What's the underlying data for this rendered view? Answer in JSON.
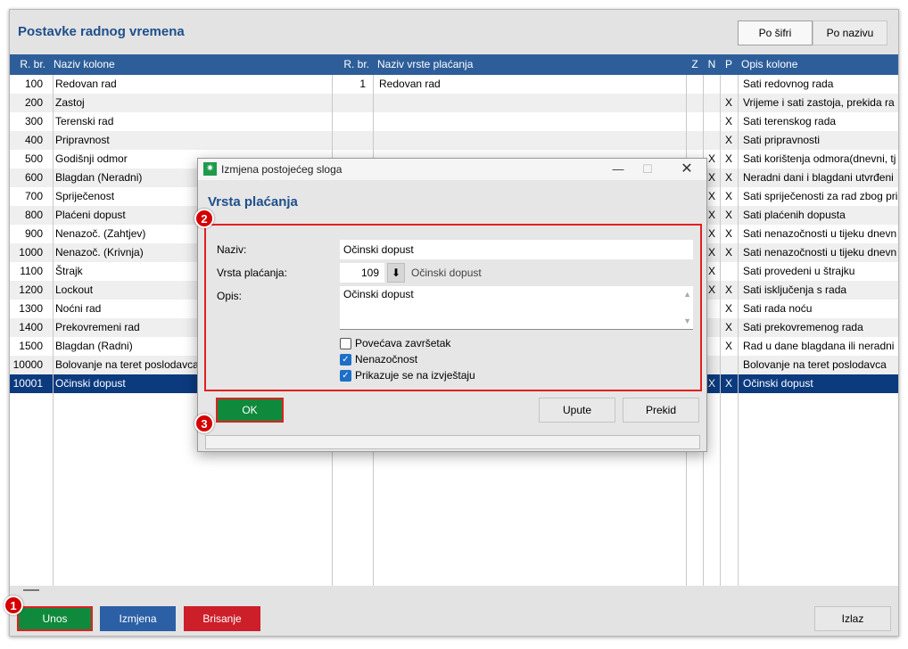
{
  "window": {
    "title": "Postavke radnog vremena"
  },
  "sort_buttons": [
    {
      "label": "Po šifri"
    },
    {
      "label": "Po nazivu"
    }
  ],
  "grid": {
    "columns": [
      "R. br.",
      "Naziv kolone",
      "R. br.",
      "Naziv vrste plaćanja",
      "Z",
      "N",
      "P",
      "Opis kolone"
    ],
    "rows": [
      {
        "rbr": "100",
        "naziv": "Redovan rad",
        "rbr2": "1",
        "vrsta": "Redovan rad",
        "z": "",
        "n": "",
        "p": "",
        "opis": "Sati redovnog rada"
      },
      {
        "rbr": "200",
        "naziv": "Zastoj",
        "rbr2": "",
        "vrsta": "",
        "z": "",
        "n": "",
        "p": "X",
        "opis": "Vrijeme i sati zastoja, prekida ra"
      },
      {
        "rbr": "300",
        "naziv": "Terenski rad",
        "rbr2": "",
        "vrsta": "",
        "z": "",
        "n": "",
        "p": "X",
        "opis": "Sati terenskog rada"
      },
      {
        "rbr": "400",
        "naziv": "Pripravnost",
        "rbr2": "",
        "vrsta": "",
        "z": "",
        "n": "",
        "p": "X",
        "opis": "Sati pripravnosti"
      },
      {
        "rbr": "500",
        "naziv": "Godišnji odmor",
        "rbr2": "",
        "vrsta": "",
        "z": "",
        "n": "X",
        "p": "X",
        "opis": "Sati korištenja odmora(dnevni, tj"
      },
      {
        "rbr": "600",
        "naziv": "Blagdan (Neradni)",
        "rbr2": "",
        "vrsta": "",
        "z": "",
        "n": "X",
        "p": "X",
        "opis": "Neradni dani i blagdani utvrđeni"
      },
      {
        "rbr": "700",
        "naziv": "Spriječenost",
        "rbr2": "",
        "vrsta": "",
        "z": "",
        "n": "X",
        "p": "X",
        "opis": "Sati spriječenosti za rad zbog pri"
      },
      {
        "rbr": "800",
        "naziv": "Plaćeni dopust",
        "rbr2": "",
        "vrsta": "",
        "z": "",
        "n": "X",
        "p": "X",
        "opis": "Sati plaćenih dopusta"
      },
      {
        "rbr": "900",
        "naziv": "Nenazoč. (Zahtjev)",
        "rbr2": "",
        "vrsta": "",
        "z": "",
        "n": "X",
        "p": "X",
        "opis": "Sati nenazočnosti u tijeku dnevn"
      },
      {
        "rbr": "1000",
        "naziv": "Nenazoč. (Krivnja)",
        "rbr2": "",
        "vrsta": "",
        "z": "",
        "n": "X",
        "p": "X",
        "opis": "Sati nenazočnosti u tijeku dnevn"
      },
      {
        "rbr": "1100",
        "naziv": "Štrajk",
        "rbr2": "",
        "vrsta": "",
        "z": "",
        "n": "X",
        "p": "",
        "opis": "Sati provedeni u štrajku"
      },
      {
        "rbr": "1200",
        "naziv": "Lockout",
        "rbr2": "",
        "vrsta": "",
        "z": "",
        "n": "X",
        "p": "X",
        "opis": "Sati isključenja s rada"
      },
      {
        "rbr": "1300",
        "naziv": "Noćni rad",
        "rbr2": "",
        "vrsta": "",
        "z": "",
        "n": "",
        "p": "X",
        "opis": "Sati rada noću"
      },
      {
        "rbr": "1400",
        "naziv": "Prekovremeni rad",
        "rbr2": "",
        "vrsta": "",
        "z": "",
        "n": "",
        "p": "X",
        "opis": "Sati prekovremenog rada"
      },
      {
        "rbr": "1500",
        "naziv": "Blagdan (Radni)",
        "rbr2": "",
        "vrsta": "",
        "z": "",
        "n": "",
        "p": "X",
        "opis": "Rad u dane blagdana ili neradni"
      },
      {
        "rbr": "10000",
        "naziv": "Bolovanje na teret poslodavca",
        "rbr2": "",
        "vrsta": "",
        "z": "",
        "n": "",
        "p": "",
        "opis": "Bolovanje na teret poslodavca"
      },
      {
        "rbr": "10001",
        "naziv": "Očinski dopust",
        "rbr2": "",
        "vrsta": "",
        "z": "",
        "n": "X",
        "p": "X",
        "opis": "Očinski dopust",
        "selected": true
      }
    ]
  },
  "bottom_buttons": [
    {
      "label": "Unos",
      "color": "#0f8a3c"
    },
    {
      "label": "Izmjena",
      "color": "#2b5fa6"
    },
    {
      "label": "Brisanje",
      "color": "#cc1f2a"
    },
    {
      "label": "Izlaz",
      "color": "#e8e8e8"
    }
  ],
  "markers": [
    "1",
    "2",
    "3"
  ],
  "dialog": {
    "title": "Izmjena postojećeg sloga",
    "heading": "Vrsta plaćanja",
    "naziv_label": "Naziv:",
    "naziv_value": "Očinski dopust",
    "vrsta_label": "Vrsta plaćanja:",
    "vrsta_code": "109",
    "vrsta_name": "Očinski dopust",
    "opis_label": "Opis:",
    "opis_value": "Očinski dopust",
    "checkboxes": [
      {
        "label": "Povećava završetak",
        "checked": false
      },
      {
        "label": "Nenazočnost",
        "checked": true
      },
      {
        "label": "Prikazuje se na izvještaju",
        "checked": true
      }
    ],
    "ok_label": "OK",
    "upute_label": "Upute",
    "prekid_label": "Prekid"
  },
  "colors": {
    "header_blue": "#2d5e9a",
    "title_blue": "#1e4f8c",
    "selection": "#0b3a7e",
    "highlight_red": "#e02020"
  }
}
